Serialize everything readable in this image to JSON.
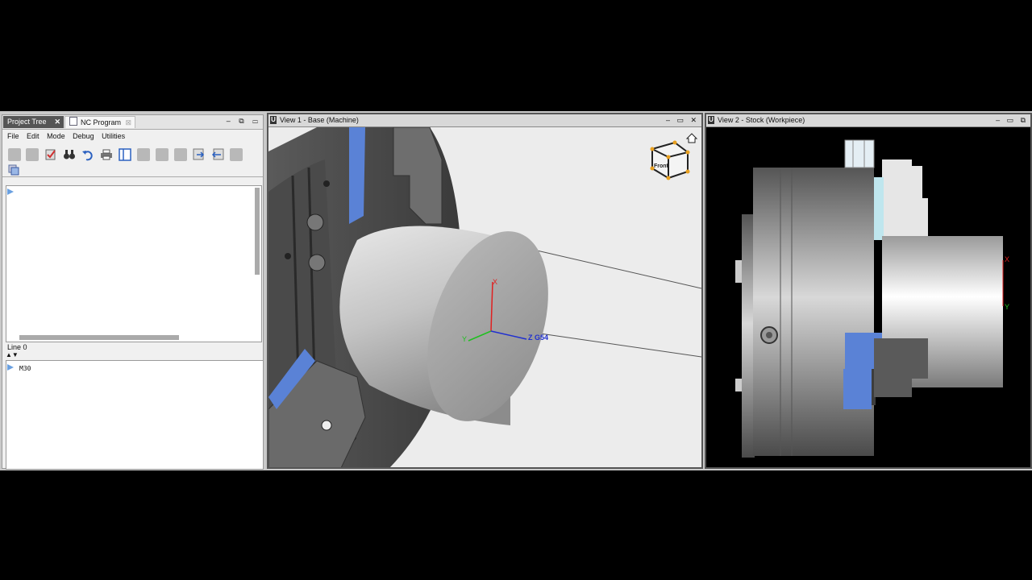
{
  "left_panel": {
    "tabs": [
      {
        "label": "Project Tree",
        "close": "✕"
      },
      {
        "label": "NC Program",
        "close": "⊠"
      }
    ],
    "panel_controls": "– ⧉ ▭",
    "menu": [
      "File",
      "Edit",
      "Mode",
      "Debug",
      "Utilities"
    ],
    "status": "Line 0",
    "program_lines": [
      "M30"
    ]
  },
  "view1": {
    "title": "View 1 - Base (Machine)",
    "controls": "– ▭ ✕",
    "axes": {
      "x": "X",
      "y": "Y",
      "z": "Z G54"
    },
    "cube_label": "Front"
  },
  "view2": {
    "title": "View 2 - Stock (Workpiece)",
    "controls": "– ▭ ⧉",
    "axes": {
      "x": "X",
      "y": "Y"
    }
  },
  "colors": {
    "jaw_blue": "#5a82d6",
    "axis_x": "#e02020",
    "axis_y": "#20c020",
    "axis_z": "#2030d0"
  }
}
